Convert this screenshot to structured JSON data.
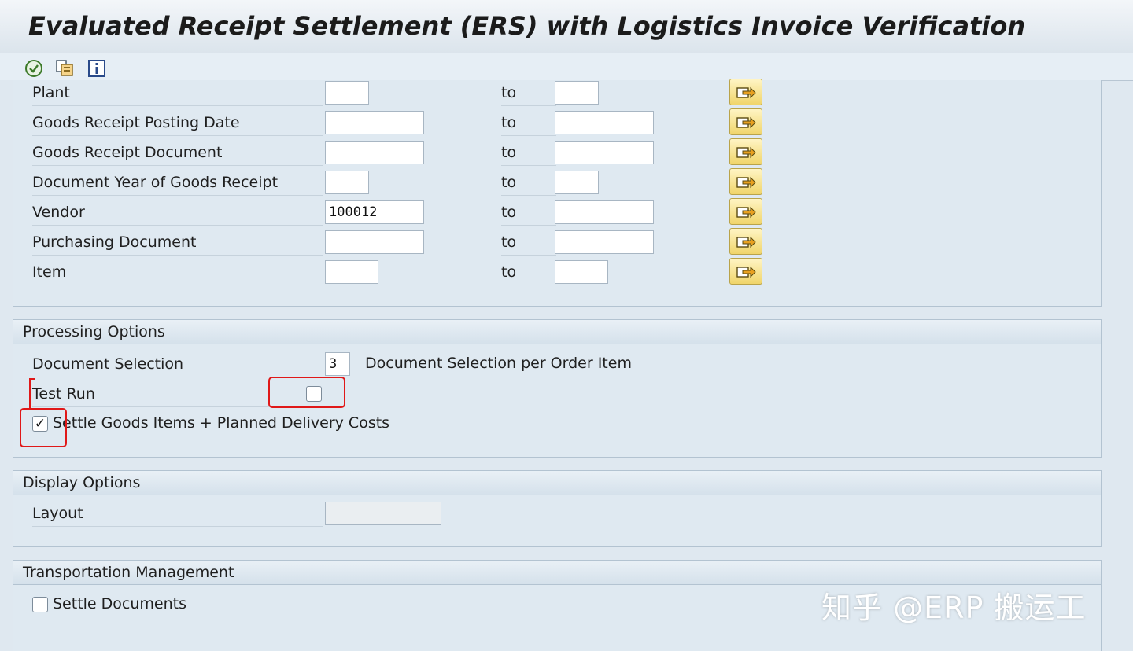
{
  "title": "Evaluated Receipt Settlement (ERS) with Logistics Invoice Verification",
  "toolbar": {
    "buttons": [
      {
        "name": "execute",
        "icon": "execute-icon"
      },
      {
        "name": "get-variant",
        "icon": "get-variant-icon"
      },
      {
        "name": "information",
        "icon": "info-icon"
      }
    ]
  },
  "selection": {
    "to_label": "to",
    "rows": [
      {
        "label": "Plant",
        "from": "",
        "to": ""
      },
      {
        "label": "Goods Receipt Posting Date",
        "from": "",
        "to": ""
      },
      {
        "label": "Goods Receipt Document",
        "from": "",
        "to": ""
      },
      {
        "label": "Document Year of Goods Receipt",
        "from": "",
        "to": ""
      },
      {
        "label": "Vendor",
        "from": "100012",
        "to": ""
      },
      {
        "label": "Purchasing Document",
        "from": "",
        "to": ""
      },
      {
        "label": "Item",
        "from": "",
        "to": ""
      }
    ]
  },
  "processing": {
    "header": "Processing Options",
    "doc_selection_label": "Document Selection",
    "doc_selection_value": "3",
    "doc_selection_desc": "Document Selection per Order Item",
    "test_run_label": "Test Run",
    "test_run_checked": false,
    "settle_label": "Settle Goods Items + Planned Delivery Costs",
    "settle_checked": true,
    "check_mark": "✓"
  },
  "display": {
    "header": "Display Options",
    "layout_label": "Layout",
    "layout_value": ""
  },
  "transport": {
    "header": "Transportation Management",
    "settle_docs_label": "Settle Documents",
    "settle_docs_checked": false
  },
  "watermark": "知乎 @ERP 搬运工",
  "colors": {
    "highlight": "#e01818",
    "more_button": "#f0d56a"
  }
}
